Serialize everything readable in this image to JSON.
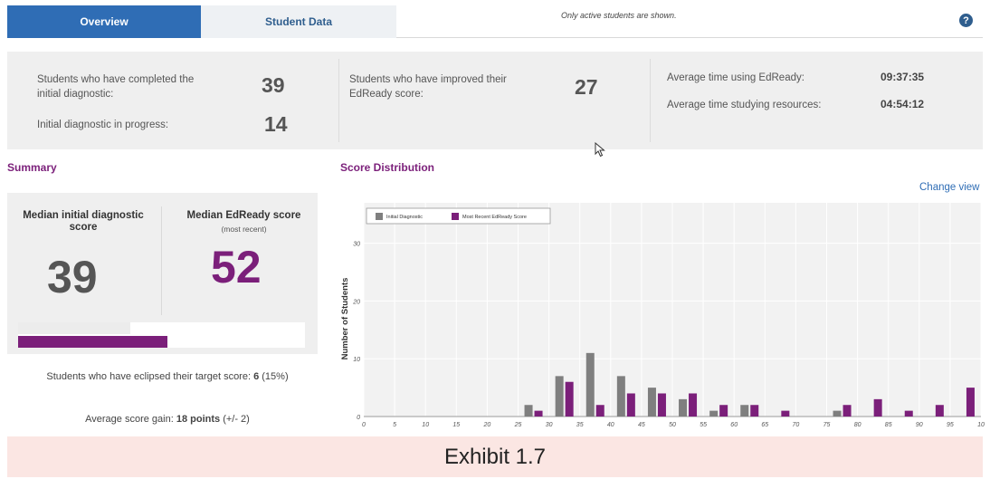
{
  "tabs": {
    "overview": "Overview",
    "student_data": "Student Data"
  },
  "active_note": "Only active students are shown.",
  "help_label": "?",
  "stats": {
    "completed_label": "Students who have completed the initial diagnostic:",
    "completed_value": "39",
    "in_progress_label": "Initial diagnostic in progress:",
    "in_progress_value": "14",
    "improved_label": "Students who have improved their EdReady score:",
    "improved_value": "27",
    "avg_time_label": "Average time using EdReady:",
    "avg_time_value": "09:37:35",
    "avg_study_label": "Average time studying resources:",
    "avg_study_value": "04:54:12"
  },
  "summary": {
    "title": "Summary",
    "median_initial_label": "Median initial diagnostic score",
    "median_initial_value": "39",
    "median_recent_label": "Median EdReady score",
    "median_recent_sub": "(most recent)",
    "median_recent_value": "52",
    "initial_fraction": 0.39,
    "recent_fraction": 0.52,
    "eclipsed_prefix": "Students who have eclipsed their target score: ",
    "eclipsed_value": "6",
    "eclipsed_suffix": " (15%)",
    "gain_prefix": "Average score gain: ",
    "gain_value": "18 points",
    "gain_suffix": " (+/- 2)"
  },
  "distribution": {
    "title": "Score Distribution",
    "change_view": "Change view"
  },
  "exhibit": "Exhibit 1.7",
  "colors": {
    "initial": "#7f7f7f",
    "recent": "#7b1f7a",
    "accent": "#2f6db5"
  },
  "chart_data": {
    "type": "bar",
    "ylabel": "Number of Students",
    "ylim": [
      0,
      37
    ],
    "yticks": [
      0,
      10,
      20,
      30
    ],
    "xticks": [
      "0",
      "5",
      "10",
      "15",
      "20",
      "25",
      "30",
      "35",
      "40",
      "45",
      "50",
      "55",
      "60",
      "65",
      "70",
      "75",
      "80",
      "85",
      "90",
      "95",
      "10"
    ],
    "xlim": [
      0,
      100
    ],
    "legend_position": "top-left",
    "series": [
      {
        "name": "Initial Diagnostic",
        "color": "#7f7f7f",
        "points": [
          [
            27.5,
            2
          ],
          [
            32.5,
            7
          ],
          [
            37.5,
            11
          ],
          [
            42.5,
            7
          ],
          [
            47.5,
            5
          ],
          [
            52.5,
            3
          ],
          [
            57.5,
            1
          ],
          [
            62.5,
            2
          ],
          [
            77.5,
            1
          ]
        ]
      },
      {
        "name": "Most Recent EdReady Score",
        "color": "#7b1f7a",
        "points": [
          [
            27.5,
            1
          ],
          [
            32.5,
            6
          ],
          [
            37.5,
            2
          ],
          [
            42.5,
            4
          ],
          [
            47.5,
            4
          ],
          [
            52.5,
            4
          ],
          [
            57.5,
            2
          ],
          [
            62.5,
            2
          ],
          [
            67.5,
            1
          ],
          [
            77.5,
            2
          ],
          [
            82.5,
            3
          ],
          [
            87.5,
            1
          ],
          [
            92.5,
            2
          ],
          [
            97.5,
            5
          ]
        ]
      }
    ]
  }
}
